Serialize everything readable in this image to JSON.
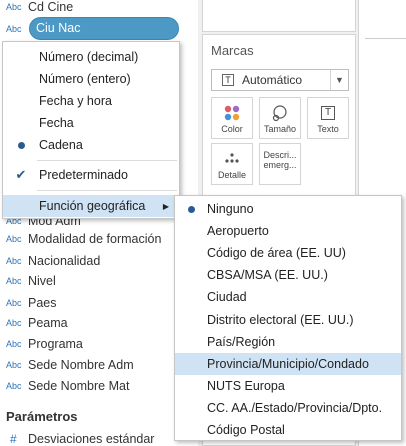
{
  "data_pane": {
    "fields": [
      {
        "type": "Abc",
        "name": "Cd Cine"
      },
      {
        "type": "Abc",
        "name": "Ciu Nac",
        "selected": true
      },
      {
        "type": "Abc",
        "name": "Mod Adm"
      },
      {
        "type": "Abc",
        "name": "Modalidad de formación"
      },
      {
        "type": "Abc",
        "name": "Nacionalidad"
      },
      {
        "type": "Abc",
        "name": "Nivel"
      },
      {
        "type": "Abc",
        "name": "Paes"
      },
      {
        "type": "Abc",
        "name": "Peama"
      },
      {
        "type": "Abc",
        "name": "Programa"
      },
      {
        "type": "Abc",
        "name": "Sede Nombre Adm"
      },
      {
        "type": "Abc",
        "name": "Sede Nombre Mat"
      }
    ],
    "parameters_header": "Parámetros",
    "parameter": {
      "type": "#",
      "name": "Desviaciones estándar"
    }
  },
  "marks_card": {
    "title": "Marcas",
    "mark_type": {
      "icon": "T",
      "label": "Automático"
    },
    "buttons": [
      {
        "label": "Color",
        "icon": "color-dots-icon"
      },
      {
        "label": "Tamaño",
        "icon": "size-circles-icon"
      },
      {
        "label": "Texto",
        "icon": "T"
      },
      {
        "label": "Detalle",
        "icon": "detail-dots-icon"
      },
      {
        "label": "Descri... emerg...",
        "label_line1": "Descri...",
        "label_line2": "emerg...",
        "icon": "tooltip-icon"
      }
    ]
  },
  "context_menu": {
    "data_types": [
      {
        "label": "Número (decimal)"
      },
      {
        "label": "Número (entero)"
      },
      {
        "label": "Fecha y hora"
      },
      {
        "label": "Fecha"
      },
      {
        "label": "Cadena",
        "active": true
      }
    ],
    "default_item": {
      "label": "Predeterminado",
      "checked": true
    },
    "geo_item": {
      "label": "Función geográfica",
      "arrow": "▶"
    }
  },
  "geo_submenu": {
    "items": [
      {
        "label": "Ninguno",
        "active": true
      },
      {
        "label": "Aeropuerto"
      },
      {
        "label": "Código de área (EE. UU)"
      },
      {
        "label": "CBSA/MSA (EE. UU.)"
      },
      {
        "label": "Ciudad"
      },
      {
        "label": "Distrito electoral (EE. UU.)"
      },
      {
        "label": "País/Región"
      },
      {
        "label": "Provincia/Municipio/Condado",
        "highlighted": true
      },
      {
        "label": "NUTS Europa"
      },
      {
        "label": "CC. AA./Estado/Provincia/Dpto."
      },
      {
        "label": "Código Postal"
      }
    ]
  },
  "colors": {
    "accent": "#4c99c5",
    "highlight": "#cfe3f5",
    "type_blue": "#2d73b9",
    "marker": "#2a5b8f"
  }
}
